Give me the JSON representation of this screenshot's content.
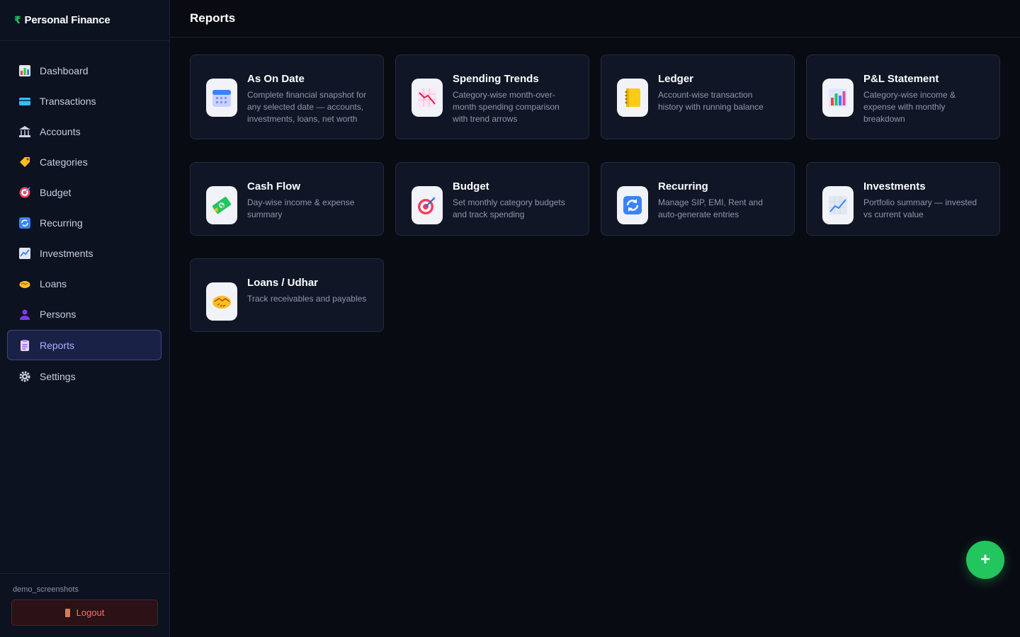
{
  "brand": {
    "symbol": "₹",
    "name": "Personal Finance"
  },
  "page_title": "Reports",
  "nav": [
    {
      "label": "Dashboard",
      "icon": "bar-chart-icon",
      "color": "#60a5fa"
    },
    {
      "label": "Transactions",
      "icon": "credit-card-icon",
      "color": "#38bdf8"
    },
    {
      "label": "Accounts",
      "icon": "bank-icon",
      "color": "#94a3b8"
    },
    {
      "label": "Categories",
      "icon": "tag-icon",
      "color": "#fbbf24"
    },
    {
      "label": "Budget",
      "icon": "target-icon",
      "color": "#f43f5e"
    },
    {
      "label": "Recurring",
      "icon": "refresh-icon",
      "color": "#3b82f6"
    },
    {
      "label": "Investments",
      "icon": "trend-chart-icon",
      "color": "#93c5fd"
    },
    {
      "label": "Loans",
      "icon": "handshake-icon",
      "color": "#fbbf24"
    },
    {
      "label": "Persons",
      "icon": "person-icon",
      "color": "#7c3aed"
    },
    {
      "label": "Reports",
      "icon": "clipboard-icon",
      "color": "#c4b5fd",
      "active": true
    },
    {
      "label": "Settings",
      "icon": "gear-icon",
      "color": "#cbd5e1"
    }
  ],
  "user": {
    "name": "demo_screenshots",
    "logout_label": "Logout"
  },
  "cards": [
    {
      "title": "As On Date",
      "desc": "Complete financial snapshot for any selected date — accounts, investments, loans, net worth",
      "icon": "calendar-icon"
    },
    {
      "title": "Spending Trends",
      "desc": "Category-wise month-over-month spending comparison with trend arrows",
      "icon": "downtrend-chart-icon"
    },
    {
      "title": "Ledger",
      "desc": "Account-wise transaction history with running balance",
      "icon": "ledger-icon"
    },
    {
      "title": "P&L Statement",
      "desc": "Category-wise income & expense with monthly breakdown",
      "icon": "bar-chart-icon"
    },
    {
      "title": "Cash Flow",
      "desc": "Day-wise income & expense summary",
      "icon": "money-icon"
    },
    {
      "title": "Budget",
      "desc": "Set monthly category budgets and track spending",
      "icon": "target-icon"
    },
    {
      "title": "Recurring",
      "desc": "Manage SIP, EMI, Rent and auto-generate entries",
      "icon": "refresh-icon"
    },
    {
      "title": "Investments",
      "desc": "Portfolio summary — invested vs current value",
      "icon": "trend-chart-icon"
    },
    {
      "title": "Loans / Udhar",
      "desc": "Track receivables and payables",
      "icon": "handshake-icon"
    }
  ],
  "fab": {
    "label": "+"
  }
}
